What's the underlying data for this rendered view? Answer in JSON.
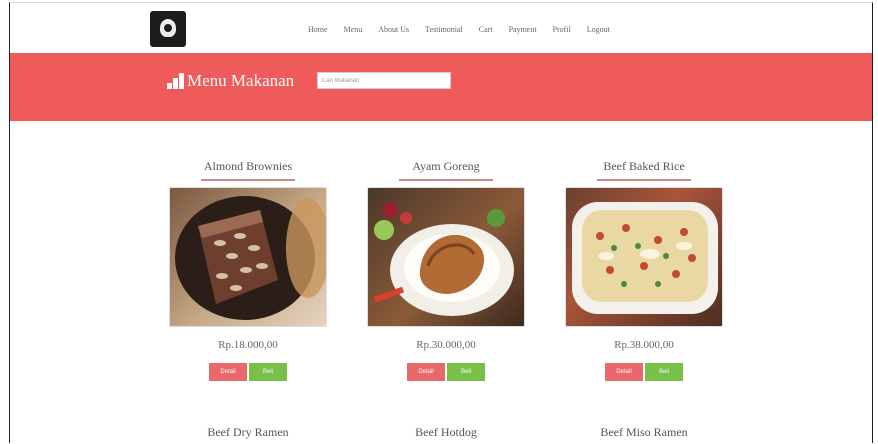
{
  "nav": {
    "links": [
      "Home",
      "Menu",
      "About Us",
      "Testimonial",
      "Cart",
      "Payment",
      "Profil",
      "Logout"
    ]
  },
  "banner": {
    "title": "Menu Makanan",
    "search_placeholder": "Cari Makanan"
  },
  "menu_items": [
    {
      "name": "Almond Brownies",
      "price": "Rp.18.000,00",
      "detail_label": "Detail",
      "buy_label": "Beli"
    },
    {
      "name": "Ayam Goreng",
      "price": "Rp.30.000,00",
      "detail_label": "Detail",
      "buy_label": "Beli"
    },
    {
      "name": "Beef Baked Rice",
      "price": "Rp.38.000,00",
      "detail_label": "Detail",
      "buy_label": "Beli"
    }
  ],
  "menu_items_row2": [
    "Beef Dry Ramen",
    "Beef Hotdog",
    "Beef Miso Ramen"
  ],
  "colors": {
    "banner": "#ef5a5a",
    "detail_button": "#e8686b",
    "buy_button": "#78c048",
    "title_underline": "#c98a8a"
  }
}
